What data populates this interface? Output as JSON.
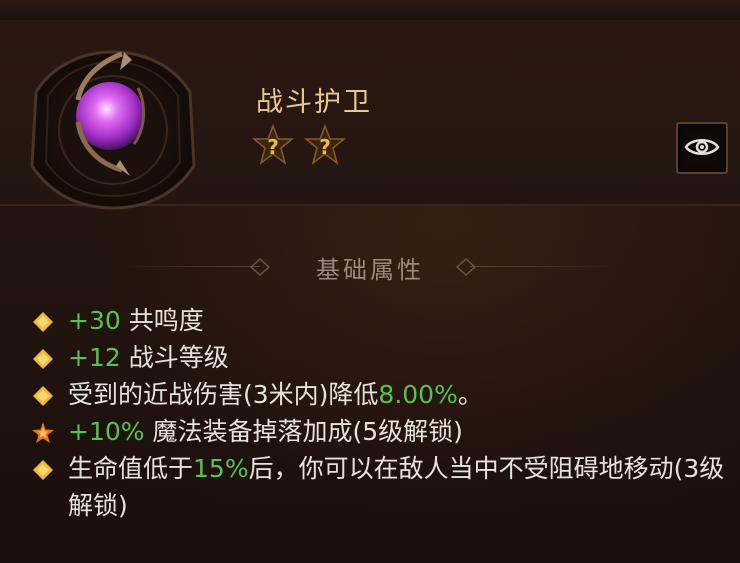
{
  "item": {
    "name": "战斗护卫",
    "star_count": 2,
    "star_symbol": "?"
  },
  "section": {
    "title": "基础属性"
  },
  "attributes": [
    {
      "pre": "",
      "value": "+30",
      "post": " 共鸣度",
      "value_green": true,
      "bullet": "diamond"
    },
    {
      "pre": "",
      "value": "+12",
      "post": " 战斗等级",
      "value_green": true,
      "bullet": "diamond"
    },
    {
      "pre": "受到的近战伤害(3米内)降低",
      "value": "8.00%",
      "post": "。",
      "value_green": true,
      "bullet": "diamond"
    },
    {
      "pre": "",
      "value": "+10%",
      "post": " 魔法装备掉落加成(5级解锁)",
      "value_green": true,
      "bullet": "star"
    },
    {
      "pre": "生命值低于",
      "value": "15%",
      "post": "后，你可以在敌人当中不受阻碍地移动(3级解锁)",
      "value_green": true,
      "bullet": "diamond"
    }
  ],
  "colors": {
    "name": "#e9c98b",
    "green": "#57c24e",
    "text": "#e7e2dc",
    "gold": "#f0b93a",
    "gem": "#c23be0"
  },
  "icons": {
    "gem": "purple-gem-icon",
    "eye": "eye-icon",
    "star": "star-rank-icon",
    "bullet": "diamond-bullet-icon"
  }
}
